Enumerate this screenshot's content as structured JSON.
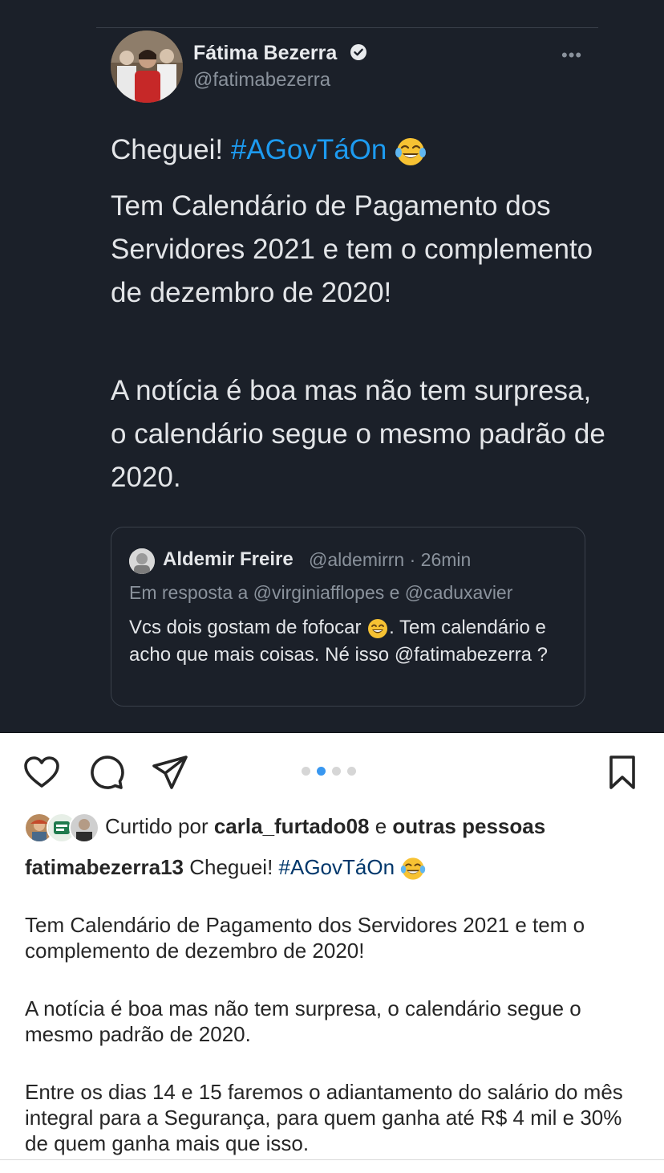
{
  "tweet": {
    "author_name": "Fátima Bezerra",
    "author_handle": "@fatimabezerra",
    "line1_text": "Cheguei! ",
    "line1_hashtag": "#AGovTáOn",
    "paragraph2": "Tem Calendário de Pagamento dos Servidores 2021 e tem o complemento de dezembro de 2020!",
    "paragraph3": "A notícia é boa mas não tem surpresa, o calendário segue o mesmo padrão de 2020.",
    "quote": {
      "author_name": "Aldemir Freire",
      "meta": "@aldemirrn · 26min",
      "reply_to": "Em resposta a @virginiafflopes e @caduxavier",
      "body_before_emoji": "Vcs dois gostam de fofocar ",
      "body_after_emoji": ". Tem calendário e acho que mais coisas. Né isso @fatimabezerra ?"
    }
  },
  "post": {
    "carousel": {
      "count": 4,
      "active_index": 1
    },
    "liked_prefix": "Curtido por ",
    "liked_user": "carla_furtado08",
    "liked_mid": " e ",
    "liked_others": "outras pessoas",
    "caption_user": "fatimabezerra13",
    "caption_line1": " Cheguei! ",
    "caption_hashtag": "#AGovTáOn",
    "caption_p2": "Tem Calendário de Pagamento dos Servidores 2021 e tem o complemento de dezembro de 2020!",
    "caption_p3": "A notícia é boa mas não tem surpresa, o calendário segue o mesmo padrão de 2020.",
    "caption_p4": "Entre os dias 14 e 15 faremos o adiantamento do salário do mês integral para a Segurança, para quem ganha até R$ 4 mil e 30% de quem ganha mais que isso."
  },
  "icons": {
    "like": "heart-icon",
    "comment": "comment-bubble-icon",
    "share": "paper-plane-icon",
    "save": "bookmark-icon",
    "verified": "verified-badge-icon",
    "more": "more-options-icon",
    "laugh_emoji": "tears-of-joy-emoji",
    "grin_emoji": "grinning-emoji"
  },
  "colors": {
    "tweet_background": "#1b2029",
    "hashtag": "#1d9bf0",
    "carousel_active": "#3897f0",
    "caption_hashtag": "#00376b"
  }
}
